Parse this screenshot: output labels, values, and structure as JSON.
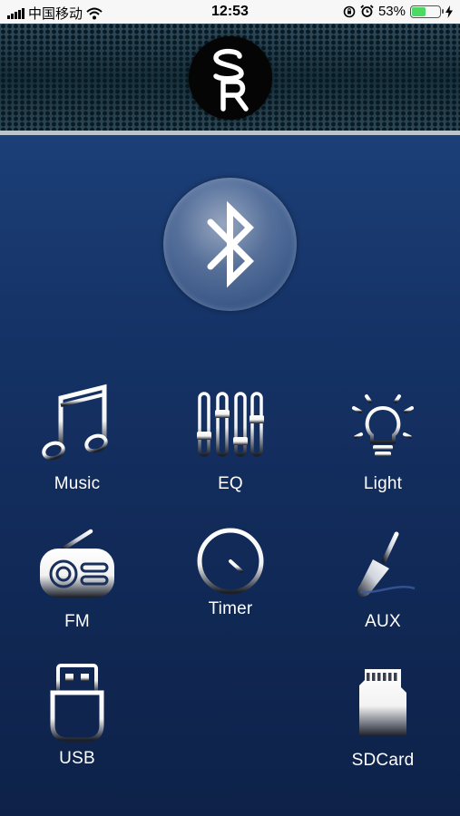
{
  "status_bar": {
    "carrier": "中国移动",
    "time": "12:53",
    "battery_percent": "53%",
    "battery_level": 0.53,
    "icons": [
      "signal-icon",
      "wifi-icon",
      "rotation-lock-icon",
      "alarm-icon",
      "battery-icon",
      "charging-icon"
    ]
  },
  "header": {
    "logo_icon": "sr-logo"
  },
  "bluetooth": {
    "icon": "bluetooth-icon"
  },
  "menu": {
    "music": {
      "label": "Music",
      "icon": "music-note-icon"
    },
    "eq": {
      "label": "EQ",
      "icon": "equalizer-icon"
    },
    "light": {
      "label": "Light",
      "icon": "light-bulb-icon"
    },
    "fm": {
      "label": "FM",
      "icon": "radio-icon"
    },
    "timer": {
      "label": "Timer",
      "icon": "clock-icon"
    },
    "aux": {
      "label": "AUX",
      "icon": "audio-jack-icon"
    },
    "usb": {
      "label": "USB",
      "icon": "usb-icon"
    },
    "sdcard": {
      "label": "SDCard",
      "icon": "sd-card-icon"
    }
  },
  "colors": {
    "background": "#0f2452",
    "icon_light": "#ffffff",
    "icon_dark": "#1a1f2a"
  }
}
